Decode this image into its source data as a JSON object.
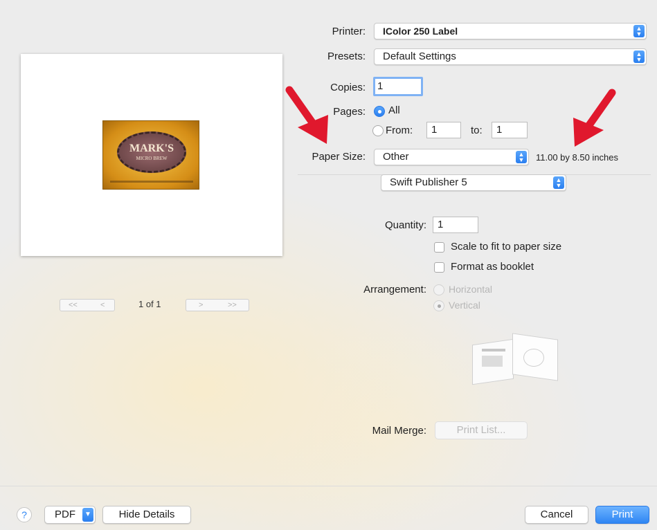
{
  "labels": {
    "printer": "Printer:",
    "presets": "Presets:",
    "copies": "Copies:",
    "pages": "Pages:",
    "paper_size": "Paper Size:",
    "quantity": "Quantity:",
    "arrangement": "Arrangement:",
    "mail_merge": "Mail Merge:",
    "to": "to:"
  },
  "printer": {
    "value": "IColor 250 Label"
  },
  "presets": {
    "value": "Default Settings"
  },
  "copies": {
    "value": "1"
  },
  "pages": {
    "all_label": "All",
    "from_label": "From:",
    "from_value": "1",
    "to_value": "1",
    "selected": "All"
  },
  "paper_size": {
    "value": "Other",
    "dimensions": "11.00 by 8.50 inches"
  },
  "section_popup": {
    "value": "Swift Publisher 5"
  },
  "quantity": {
    "value": "1"
  },
  "options": {
    "scale_to_fit": "Scale to fit to paper size",
    "format_booklet": "Format as booklet"
  },
  "arrangement": {
    "horizontal": "Horizontal",
    "vertical": "Vertical",
    "selected": "Vertical"
  },
  "mail_merge": {
    "button": "Print List..."
  },
  "preview": {
    "page_indicator": "1 of 1",
    "first": "<<",
    "prev": "<",
    "next": ">",
    "last": ">>",
    "logo_line1": "MARK'S",
    "logo_line2": "MICRO BREW"
  },
  "footer": {
    "help": "?",
    "pdf": "PDF",
    "hide_details": "Hide Details",
    "cancel": "Cancel",
    "print": "Print"
  },
  "colors": {
    "accent": "#2f86f3",
    "annotation_arrow": "#e0182d"
  }
}
